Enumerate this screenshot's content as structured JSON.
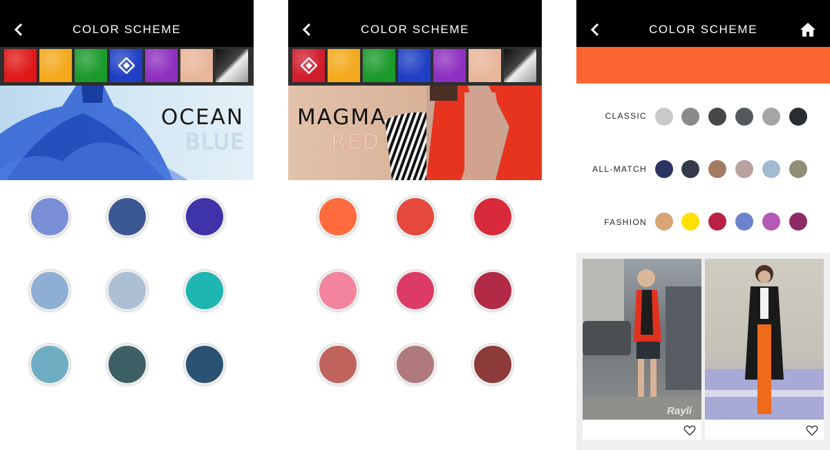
{
  "screens": [
    {
      "title": "COLOR SCHEME",
      "swatches": [
        "#e01717",
        "#f3a91b",
        "#1a9a2b",
        "#1f3fc4",
        "#8e2fc0",
        "#e8b699",
        "metallic"
      ],
      "selected_swatch": 3,
      "banner": {
        "line1": "OCEAN",
        "line2": "BLUE"
      },
      "colors": [
        "#7b8fd6",
        "#3b5894",
        "#3e33a8",
        "#8eaed4",
        "#adbfd2",
        "#1fb5b0",
        "#6fadc3",
        "#3d6066",
        "#2b5272"
      ]
    },
    {
      "title": "COLOR SCHEME",
      "swatches": [
        "#d01c2b",
        "#f3a91b",
        "#1a9a2b",
        "#1f3fc4",
        "#8e2fc0",
        "#e8b699",
        "metallic"
      ],
      "selected_swatch": 0,
      "banner": {
        "line1": "MAGMA",
        "line2": "RED"
      },
      "colors": [
        "#ff6b3d",
        "#e5483d",
        "#d82a3a",
        "#f3849e",
        "#dc3b67",
        "#b32a46",
        "#c0635d",
        "#b07a7c",
        "#8c3a3a"
      ]
    },
    {
      "title": "COLOR SCHEME",
      "accent": "#ff6533",
      "rows": [
        {
          "label": "CLASSIC",
          "colors": [
            "#c9c9c9",
            "#8a8a8a",
            "#484848",
            "#54595c",
            "#a3a5a6",
            "#2a2d30"
          ]
        },
        {
          "label": "ALL-MATCH",
          "colors": [
            "#2b3460",
            "#353a4a",
            "#a27b63",
            "#b8a19f",
            "#a3bbd1",
            "#8f8f77"
          ]
        },
        {
          "label": "FASHION",
          "colors": [
            "#d7a472",
            "#fde100",
            "#ba1f44",
            "#6b83cc",
            "#b55ab4",
            "#8e2a66"
          ]
        }
      ],
      "gallery_watermark": "Rayli"
    }
  ]
}
